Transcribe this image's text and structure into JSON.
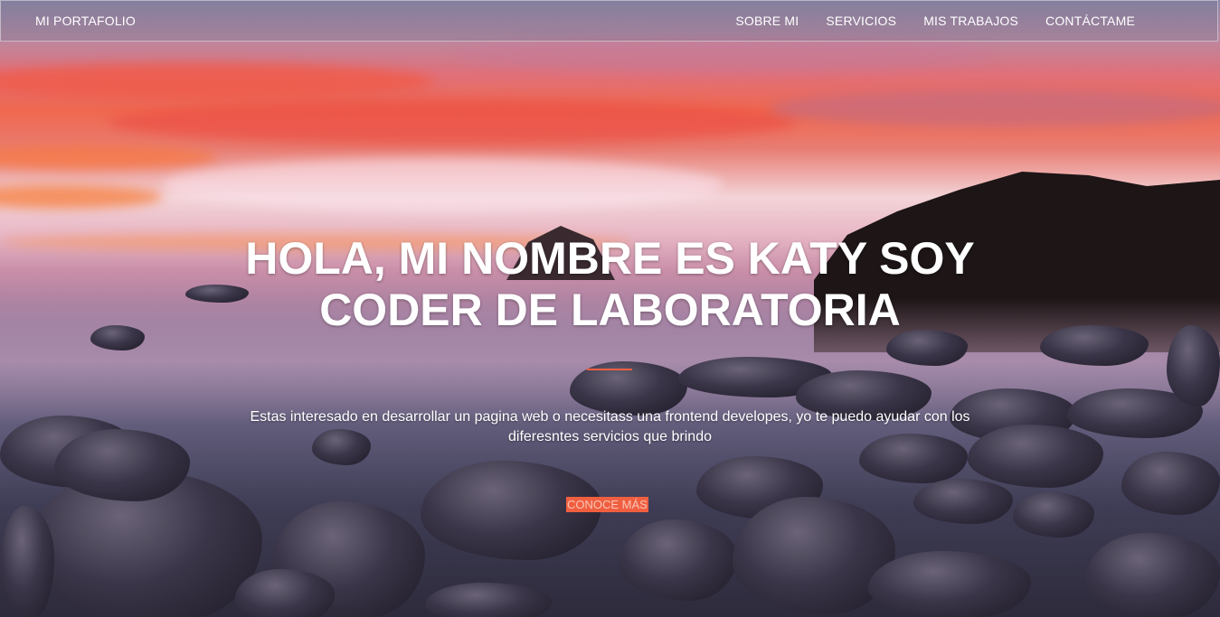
{
  "nav": {
    "brand": "MI PORTAFOLIO",
    "links": [
      {
        "label": "SOBRE MI"
      },
      {
        "label": "SERVICIOS"
      },
      {
        "label": "MIS TRABAJOS"
      },
      {
        "label": "CONTÁCTAME"
      }
    ]
  },
  "hero": {
    "headline": "HOLA, MI NOMBRE ES KATY SOY CODER DE LABORATORIA",
    "intro": "Estas interesado en desarrollar un pagina web o necesitass una frontend developes, yo te puedo ayudar con los diferesntes servicios que brindo",
    "cta_label": "CONOCE MÁS"
  },
  "colors": {
    "accent": "#f05f40",
    "text": "#ffffff"
  }
}
